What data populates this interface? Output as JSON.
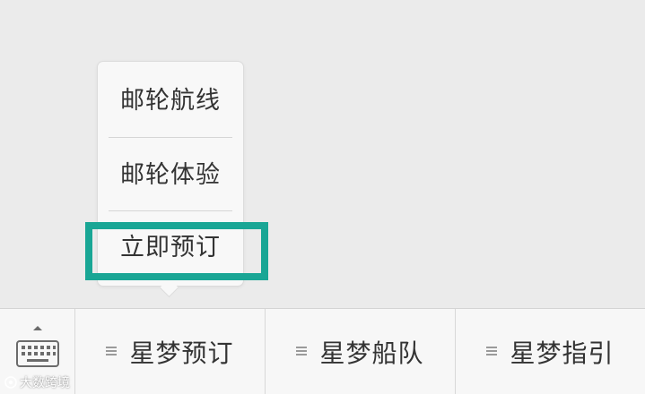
{
  "popup_menu": {
    "items": [
      {
        "label": "邮轮航线"
      },
      {
        "label": "邮轮体验"
      },
      {
        "label": "立即预订"
      }
    ],
    "highlighted_index": 2
  },
  "bottom_bar": {
    "keyboard_toggle_icon": "keyboard-icon",
    "tabs": [
      {
        "label": "星梦预订",
        "icon": "menu-lines-icon"
      },
      {
        "label": "星梦船队",
        "icon": "menu-lines-icon"
      },
      {
        "label": "星梦指引",
        "icon": "menu-lines-icon"
      }
    ]
  },
  "watermark": {
    "text": "大数跨境"
  },
  "colors": {
    "background": "#ebebeb",
    "highlight": "#19a695",
    "text": "#333333",
    "bar": "#f7f7f7"
  }
}
